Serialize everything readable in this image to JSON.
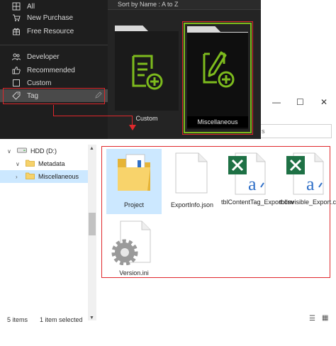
{
  "sidebar": {
    "items": [
      {
        "label": "All",
        "icon": "grid-icon"
      },
      {
        "label": "New Purchase",
        "icon": "cart-icon"
      },
      {
        "label": "Free Resource",
        "icon": "gift-icon"
      },
      {
        "label": "Developer",
        "icon": "people-icon"
      },
      {
        "label": "Recommended",
        "icon": "thumbs-up-icon"
      },
      {
        "label": "Custom",
        "icon": "square-icon"
      },
      {
        "label": "Tag",
        "icon": "tag-icon"
      }
    ]
  },
  "main": {
    "sort_label": "Sort by Name : A to Z",
    "cards": [
      {
        "label": "Custom",
        "selected": false
      },
      {
        "label": "Miscellaneous",
        "selected": true
      }
    ],
    "accent": "#7dbb1d",
    "highlight": "#e0282c"
  },
  "explorer": {
    "search_fragment": "s",
    "tree": [
      {
        "label": "HDD (D:)"
      },
      {
        "label": "Metadata"
      },
      {
        "label": "Miscellaneous"
      }
    ],
    "files": [
      {
        "name": "Project",
        "type": "folder"
      },
      {
        "name": "ExportInfo.json",
        "type": "document"
      },
      {
        "name": "tblContentTag_Export.csv",
        "type": "excel-csv"
      },
      {
        "name": "tblInvisible_Export.csv",
        "type": "excel-csv"
      },
      {
        "name": "Version.ini",
        "type": "settings"
      }
    ],
    "status": {
      "items": "5 items",
      "selected": "1 item selected"
    }
  }
}
